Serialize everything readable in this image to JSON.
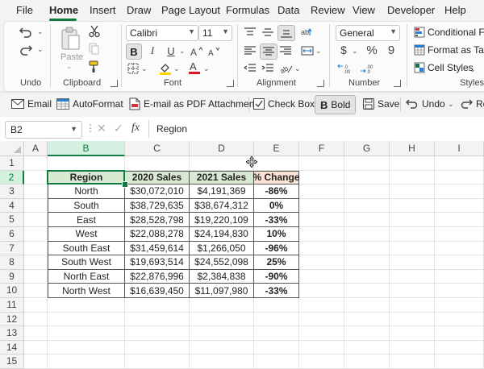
{
  "menu": [
    "File",
    "Home",
    "Insert",
    "Draw",
    "Page Layout",
    "Formulas",
    "Data",
    "Review",
    "View",
    "Developer",
    "Help"
  ],
  "ribbon": {
    "groups": {
      "undo": "Undo",
      "clipboard": "Clipboard",
      "font": "Font",
      "alignment": "Alignment",
      "number": "Number",
      "styles": "Styles"
    },
    "paste_label": "Paste",
    "font_name": "Calibri",
    "font_size": "11",
    "bold_glyph": "B",
    "italic_glyph": "I",
    "underline_glyph": "U",
    "font_color_glyph": "A",
    "number_format": "General",
    "currency_glyph": "$",
    "percent_glyph": "%",
    "comma_glyph": "9",
    "styles_items": [
      "Conditional Fo",
      "Format as Table",
      "Cell Styles"
    ],
    "accent": "#107c41",
    "font_color": "#e81123",
    "fill_color": "#ffd400"
  },
  "qat": {
    "email": "Email",
    "autoformat": "AutoFormat",
    "email_pdf": "E-mail as PDF Attachment",
    "checkbox": "Check Box",
    "bold": "Bold",
    "save": "Save",
    "undo": "Undo",
    "redo": "Re"
  },
  "formula_bar": {
    "name_box": "B2",
    "fx": "fx",
    "content": "Region"
  },
  "columns": [
    "A",
    "B",
    "C",
    "D",
    "E",
    "F",
    "G",
    "H",
    "I"
  ],
  "rows": [
    "1",
    "2",
    "3",
    "4",
    "5",
    "6",
    "7",
    "8",
    "9",
    "10",
    "11",
    "12",
    "13",
    "14",
    "15"
  ],
  "table": {
    "headers": [
      "Region",
      "2020 Sales",
      "2021 Sales",
      "% Change"
    ],
    "rows": [
      [
        "North",
        "$30,072,010",
        "$4,191,369",
        "-86%"
      ],
      [
        "South",
        "$38,729,635",
        "$38,674,312",
        "0%"
      ],
      [
        "East",
        "$28,528,798",
        "$19,220,109",
        "-33%"
      ],
      [
        "West",
        "$22,088,278",
        "$24,194,830",
        "10%"
      ],
      [
        "South East",
        "$31,459,614",
        "$1,266,050",
        "-96%"
      ],
      [
        "South West",
        "$19,693,514",
        "$24,552,098",
        "25%"
      ],
      [
        "North East",
        "$22,876,996",
        "$2,384,838",
        "-90%"
      ],
      [
        "North West",
        "$16,639,450",
        "$11,097,980",
        "-33%"
      ]
    ],
    "header_fill": "#d9ead3",
    "change_header_fill": "#fbe2d5"
  }
}
